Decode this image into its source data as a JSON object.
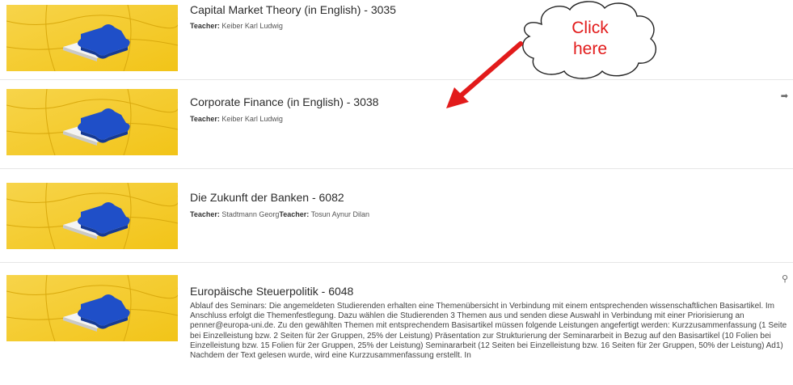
{
  "courses": [
    {
      "title": "Capital Market Theory (in English) - 3035",
      "teacher_label": "Teacher:",
      "teacher_names": "Keiber Karl Ludwig"
    },
    {
      "title": "Corporate Finance (in English) - 3038",
      "teacher_label": "Teacher:",
      "teacher_names": "Keiber Karl Ludwig",
      "side_icon": "arrow-right-icon"
    },
    {
      "title": "Die Zukunft der Banken - 6082",
      "teacher_label": "Teacher:",
      "teacher_names": "Stadtmann Georg",
      "teacher_label_2": "Teacher:",
      "teacher_names_2": "Tosun Aynur Dilan"
    },
    {
      "title": "Europäische Steuerpolitik - 6048",
      "side_icon": "search-icon",
      "description": "Ablauf des Seminars: Die angemeldeten Studierenden erhalten eine Themenübersicht in Verbindung mit einem entsprechenden wissenschaftlichen Basisartikel. Im Anschluss erfolgt die Themenfestlegung. Dazu wählen die Studierenden 3 Themen aus und senden diese Auswahl in Verbindung mit einer Priorisierung an penner@europa-uni.de. Zu den gewählten Themen mit entsprechendem Basisartikel müssen folgende Leistungen angefertigt werden:   Kurzzusammenfassung (1 Seite bei Einzelleistung bzw. 2 Seiten für 2er Gruppen, 25% der Leistung) Präsentation zur Strukturierung der Seminararbeit in Bezug auf den Basisartikel (10 Folien bei Einzelleistung bzw. 15 Folien für 2er Gruppen, 25% der Leistung) Seminararbeit (12 Seiten bei Einzelleistung bzw. 16 Seiten für 2er Gruppen, 50% der Leistung)   Ad1) Nachdem der Text gelesen wurde, wird eine Kurzzusammenfassung erstellt. In"
    }
  ],
  "callout": {
    "line1": "Click",
    "line2": "here",
    "color": "#e21b1b"
  },
  "colors": {
    "puzzle_yellow": "#f2c418",
    "puzzle_blue": "#1f4fc8"
  }
}
